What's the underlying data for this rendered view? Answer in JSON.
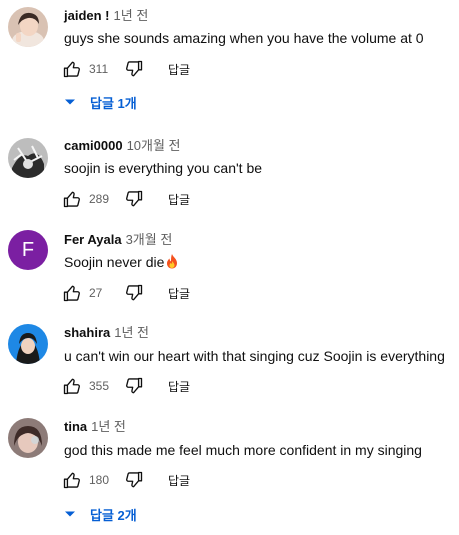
{
  "comments": [
    {
      "author": "jaiden !",
      "time": "1년 전",
      "text": "guys she sounds amazing when you have the volume at 0",
      "likes": "311",
      "reply_label": "답글",
      "replies_label": "답글 1개"
    },
    {
      "author": "cami0000",
      "time": "10개월 전",
      "text": "soojin is everything you can't be",
      "likes": "289",
      "reply_label": "답글"
    },
    {
      "author": "Fer Ayala",
      "time": "3개월 전",
      "text": "Soojin never die",
      "avatar_letter": "F",
      "avatar_color": "#7b1fa2",
      "likes": "27",
      "reply_label": "답글"
    },
    {
      "author": "shahira",
      "time": "1년 전",
      "text": "u can't win our heart with that singing cuz Soojin is everything",
      "likes": "355",
      "reply_label": "답글"
    },
    {
      "author": "tina",
      "time": "1년 전",
      "text": "god this made me feel much more confident in my singing",
      "likes": "180",
      "reply_label": "답글",
      "replies_label": "답글 2개"
    }
  ],
  "colors": {
    "link_blue": "#065fd4",
    "meta_gray": "#606060"
  }
}
